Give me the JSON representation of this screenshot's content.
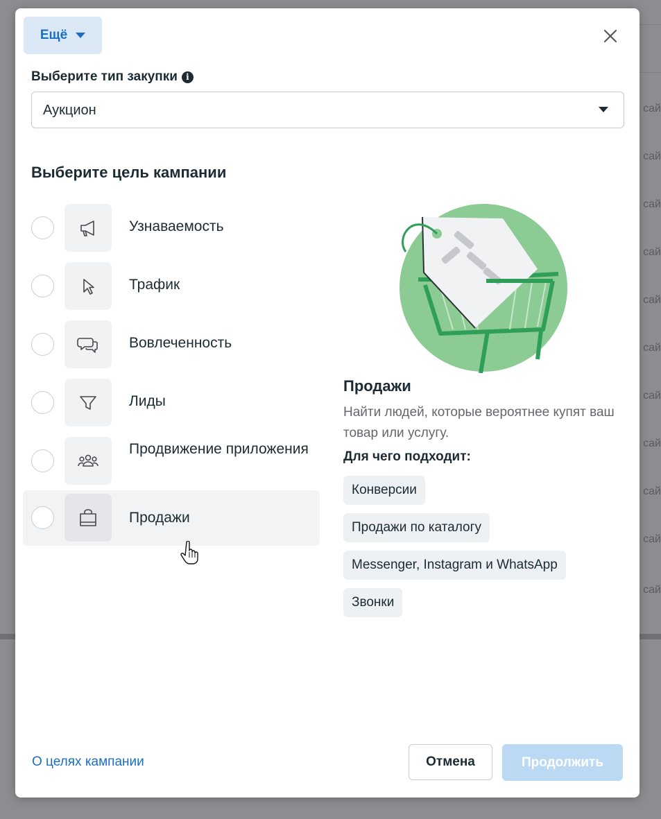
{
  "background": {
    "row_snippets": [
      "а сай",
      "а сай",
      "а сай",
      "а сай",
      "а сай",
      "а сай",
      "а сай",
      "а сай",
      "а сай",
      "а сай",
      "а сай",
      "а сай",
      "а сай"
    ]
  },
  "header": {
    "more_label": "Ещё"
  },
  "purchase_type": {
    "label": "Выберите тип закупки",
    "info_icon": "i",
    "selected_value": "Аукцион"
  },
  "objective": {
    "title": "Выберите цель кампании",
    "options": [
      {
        "label": "Узнаваемость",
        "icon": "megaphone-icon"
      },
      {
        "label": "Трафик",
        "icon": "cursor-icon"
      },
      {
        "label": "Вовлеченность",
        "icon": "chat-bubbles-icon"
      },
      {
        "label": "Лиды",
        "icon": "funnel-icon"
      },
      {
        "label": "Продвижение приложения",
        "icon": "people-icon"
      },
      {
        "label": "Продажи",
        "icon": "shopping-bag-icon"
      }
    ],
    "hovered_index": 5
  },
  "detail": {
    "title": "Продажи",
    "description": "Найти людей, которые вероятнее купят ваш товар или услугу.",
    "fit_title": "Для чего подходит:",
    "chips": [
      "Конверсии",
      "Продажи по каталогу",
      "Messenger, Instagram и WhatsApp",
      "Звонки"
    ],
    "illustration": "shopping-cart-with-tag"
  },
  "footer": {
    "learn_link": "О целях кампании",
    "cancel_label": "Отмена",
    "continue_label": "Продолжить"
  },
  "colors": {
    "accent": "#1a6fc2",
    "illustration_green": "#8ccb94",
    "disabled_button": "#bcd9f3"
  }
}
